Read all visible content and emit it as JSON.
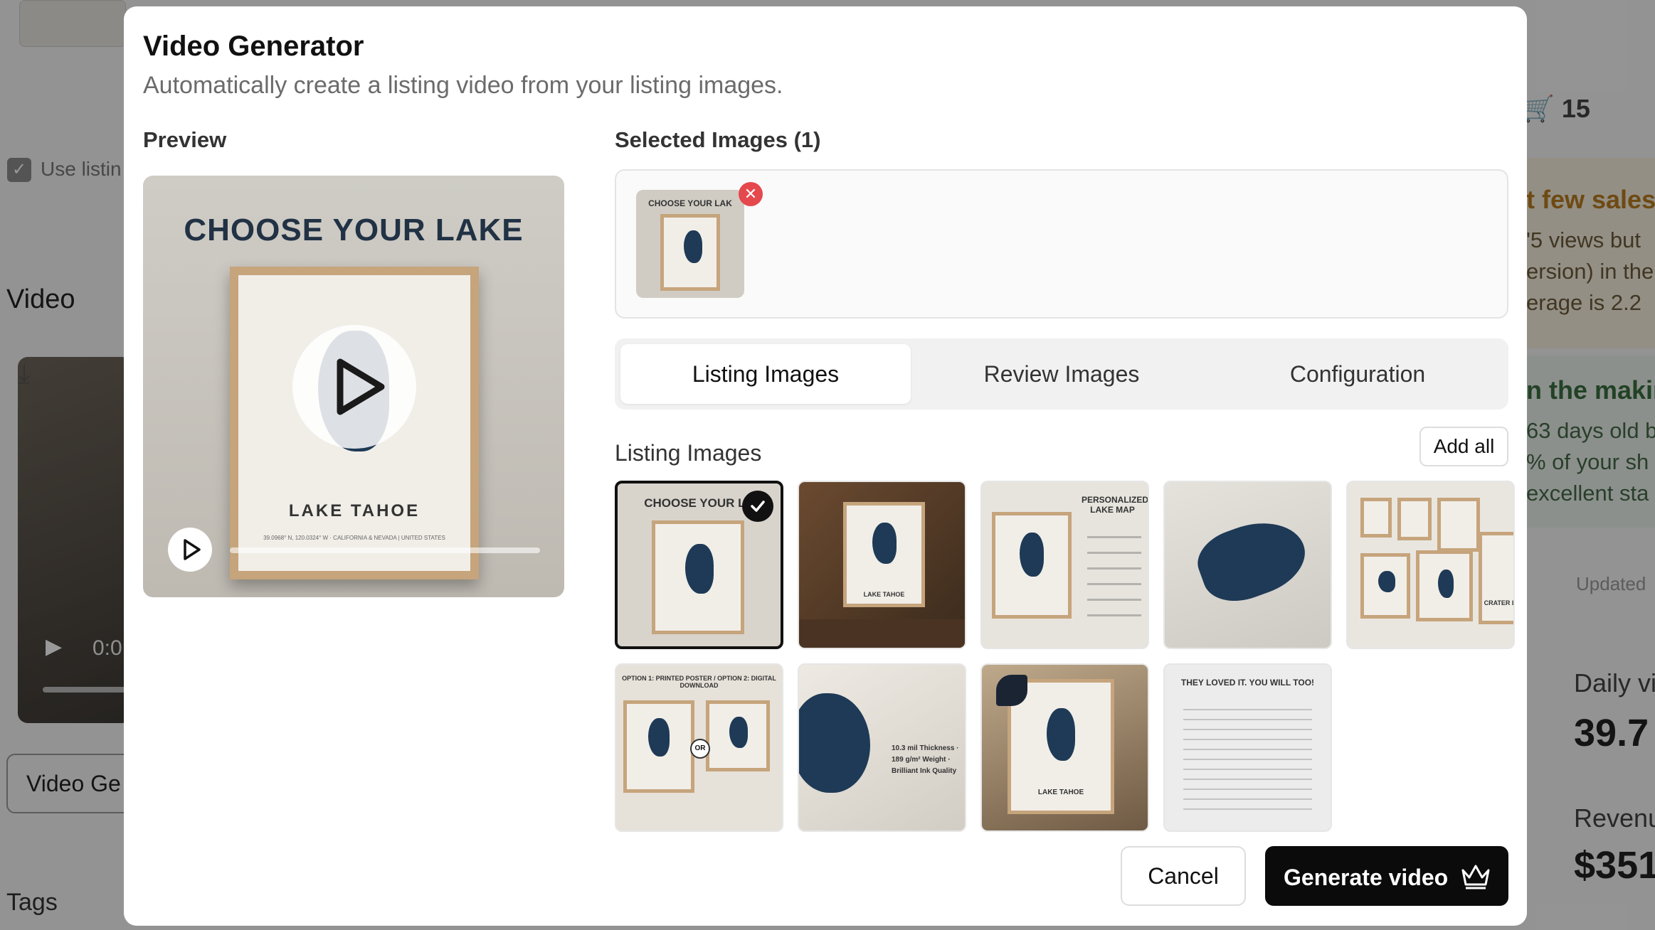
{
  "background": {
    "use_listing_label": "Use listin",
    "video_title": "Video",
    "video_time": "0:0",
    "video_generator_button": "Video Ge",
    "tags_title": "Tags",
    "cart_count": "15",
    "warning_card": {
      "title": "t few sales",
      "lines": [
        "'5 views but",
        "ersion) in the",
        "erage is 2.2"
      ]
    },
    "positive_card": {
      "title": "n the makin",
      "lines": [
        "63 days old b",
        "% of your sh",
        "excellent sta"
      ]
    },
    "updated_label": "Updated",
    "daily_label": "Daily vi",
    "daily_value": "39.7",
    "revenue_label": "Revenu",
    "revenue_value": "$351"
  },
  "modal": {
    "title": "Video Generator",
    "subtitle": "Automatically create a listing video from your listing images.",
    "preview_label": "Preview",
    "preview": {
      "heading": "CHOOSE YOUR LAKE",
      "lake_name": "LAKE TAHOE",
      "coords": "39.0968° N, 120.0324° W · CALIFORNIA & NEVADA | UNITED STATES"
    },
    "selected_label": "Selected Images (1)",
    "selected_thumb_text": "CHOOSE YOUR LAK",
    "tabs": [
      {
        "label": "Listing Images",
        "active": true
      },
      {
        "label": "Review Images",
        "active": false
      },
      {
        "label": "Configuration",
        "active": false
      }
    ],
    "listing_images_label": "Listing Images",
    "add_all_label": "Add all",
    "images": [
      {
        "name": "choose-your-lake",
        "text": "CHOOSE YOUR LA",
        "selected": true
      },
      {
        "name": "wooden-room-frame",
        "text": "LAKE TAHOE",
        "selected": false
      },
      {
        "name": "personalized-lake-map",
        "text": "PERSONALIZED LAKE MAP",
        "selected": false
      },
      {
        "name": "lake-closeup",
        "text": "",
        "selected": false
      },
      {
        "name": "sizes-gallery",
        "text": "CRATER L",
        "selected": false
      },
      {
        "name": "option-poster-download",
        "text": "OPTION 1: PRINTED POSTER / OPTION 2: DIGITAL DOWNLOAD",
        "selected": false
      },
      {
        "name": "paper-detail",
        "text": "10.3 mil Thickness · 189 g/m² Weight · Brilliant Ink Quality",
        "selected": false
      },
      {
        "name": "gift-frame-ribbon",
        "text": "LAKE TAHOE",
        "selected": false
      },
      {
        "name": "reviews-card",
        "text": "THEY LOVED IT. YOU WILL TOO!",
        "selected": false
      }
    ],
    "cancel_label": "Cancel",
    "generate_label": "Generate video"
  },
  "colors": {
    "primary": "#0b0b0b",
    "remove": "#e5484d",
    "lake": "#1e3a56",
    "frame": "#c6a47c"
  }
}
